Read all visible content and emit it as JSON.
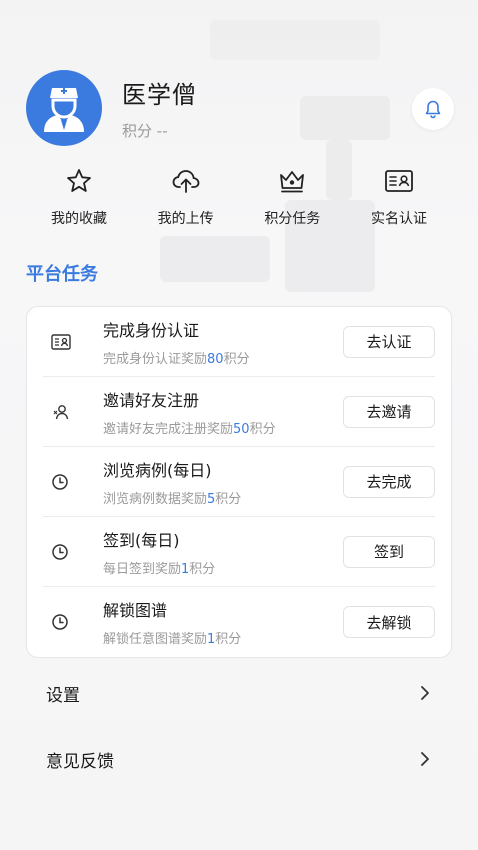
{
  "profile": {
    "name": "医学僧",
    "points_label": "积分",
    "points_value": "--"
  },
  "quick_actions": [
    {
      "label": "我的收藏",
      "icon": "star-icon"
    },
    {
      "label": "我的上传",
      "icon": "cloud-upload-icon"
    },
    {
      "label": "积分任务",
      "icon": "crown-icon"
    },
    {
      "label": "实名认证",
      "icon": "id-card-icon"
    }
  ],
  "section_title": "平台任务",
  "tasks": [
    {
      "icon": "id-card-icon",
      "title": "完成身份认证",
      "desc_prefix": "完成身份认证奖励",
      "desc_num": "80",
      "desc_suffix": "积分",
      "button": "去认证"
    },
    {
      "icon": "invite-user-icon",
      "title": "邀请好友注册",
      "desc_prefix": "邀请好友完成注册奖励",
      "desc_num": "50",
      "desc_suffix": "积分",
      "button": "去邀请"
    },
    {
      "icon": "clock-icon",
      "title": "浏览病例(每日)",
      "desc_prefix": "浏览病例数据奖励",
      "desc_num": "5",
      "desc_suffix": "积分",
      "button": "去完成"
    },
    {
      "icon": "clock-icon",
      "title": "签到(每日)",
      "desc_prefix": "每日签到奖励",
      "desc_num": "1",
      "desc_suffix": "积分",
      "button": "签到"
    },
    {
      "icon": "clock-icon",
      "title": "解锁图谱",
      "desc_prefix": "解锁任意图谱奖励",
      "desc_num": "1",
      "desc_suffix": "积分",
      "button": "去解锁"
    }
  ],
  "menu": [
    {
      "label": "设置"
    },
    {
      "label": "意见反馈"
    }
  ],
  "colors": {
    "accent": "#3b7be0",
    "muted": "#9a9a9a"
  }
}
